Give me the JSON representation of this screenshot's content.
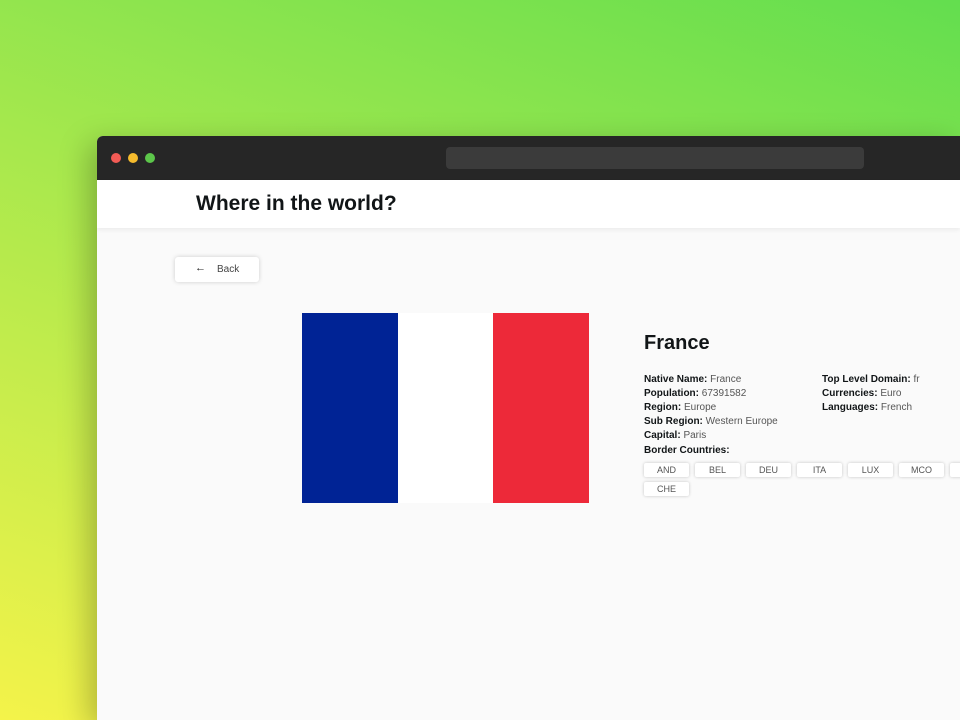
{
  "app_title": "Where in the world?",
  "back_label": "Back",
  "country": {
    "name": "France",
    "flag_colors": [
      "#002395",
      "#ffffff",
      "#ed2939"
    ],
    "native_name_label": "Native Name:",
    "native_name": "France",
    "population_label": "Population:",
    "population": "67391582",
    "region_label": "Region:",
    "region": "Europe",
    "subregion_label": "Sub Region:",
    "subregion": "Western Europe",
    "capital_label": "Capital:",
    "capital": "Paris",
    "tld_label": "Top Level Domain:",
    "tld": "fr",
    "currencies_label": "Currencies:",
    "currencies": "Euro",
    "languages_label": "Languages:",
    "languages": "French",
    "border_label": "Border Countries:",
    "borders": [
      "AND",
      "BEL",
      "DEU",
      "ITA",
      "LUX",
      "MCO",
      "",
      "CHE"
    ]
  }
}
